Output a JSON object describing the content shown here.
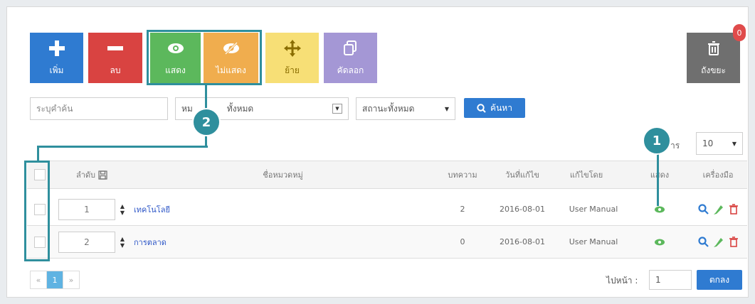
{
  "toolbar": {
    "add_label": "เพิ่ม",
    "delete_label": "ลบ",
    "show_label": "แสดง",
    "hide_label": "ไม่แสดง",
    "move_label": "ย้าย",
    "copy_label": "คัดลอก",
    "trash_label": "ถังขยะ",
    "trash_count": "0"
  },
  "filters": {
    "keyword_placeholder": "ระบุคำค้น",
    "category_value": "หมวดหมู่ทั้งหมด",
    "category_prefix": "หม",
    "category_suffix": "ทั้งหมด",
    "status_value": "สถานะทั้งหมด",
    "search_label": "ค้นหา"
  },
  "per_page": {
    "label": "รายการ",
    "label_fragment": "าร",
    "value": "10"
  },
  "callouts": {
    "one": "1",
    "two": "2"
  },
  "table": {
    "headers": {
      "order": "ลำดับ",
      "name": "ชื่อหมวดหมู่",
      "articles": "บทความ",
      "updated": "วันที่แก้ไข",
      "editor": "แก้ไขโดย",
      "visible": "แสดง",
      "tools": "เครื่องมือ"
    },
    "rows": [
      {
        "order": "1",
        "name": "เทคโนโลยี",
        "articles": "2",
        "updated": "2016-08-01",
        "editor": "User Manual"
      },
      {
        "order": "2",
        "name": "การตลาด",
        "articles": "0",
        "updated": "2016-08-01",
        "editor": "User Manual"
      }
    ]
  },
  "pagination": {
    "prev": "«",
    "current": "1",
    "next": "»"
  },
  "goto": {
    "label": "ไปหน้า :",
    "value": "1",
    "button": "ตกลง"
  },
  "colors": {
    "add": "#2f7bd1",
    "delete": "#d94341",
    "show": "#5cb85c",
    "hide": "#f0ad4e",
    "move": "#f7df76",
    "copy": "#a497d5",
    "trash": "#6f6f6f",
    "callout": "#2f8f9d"
  }
}
